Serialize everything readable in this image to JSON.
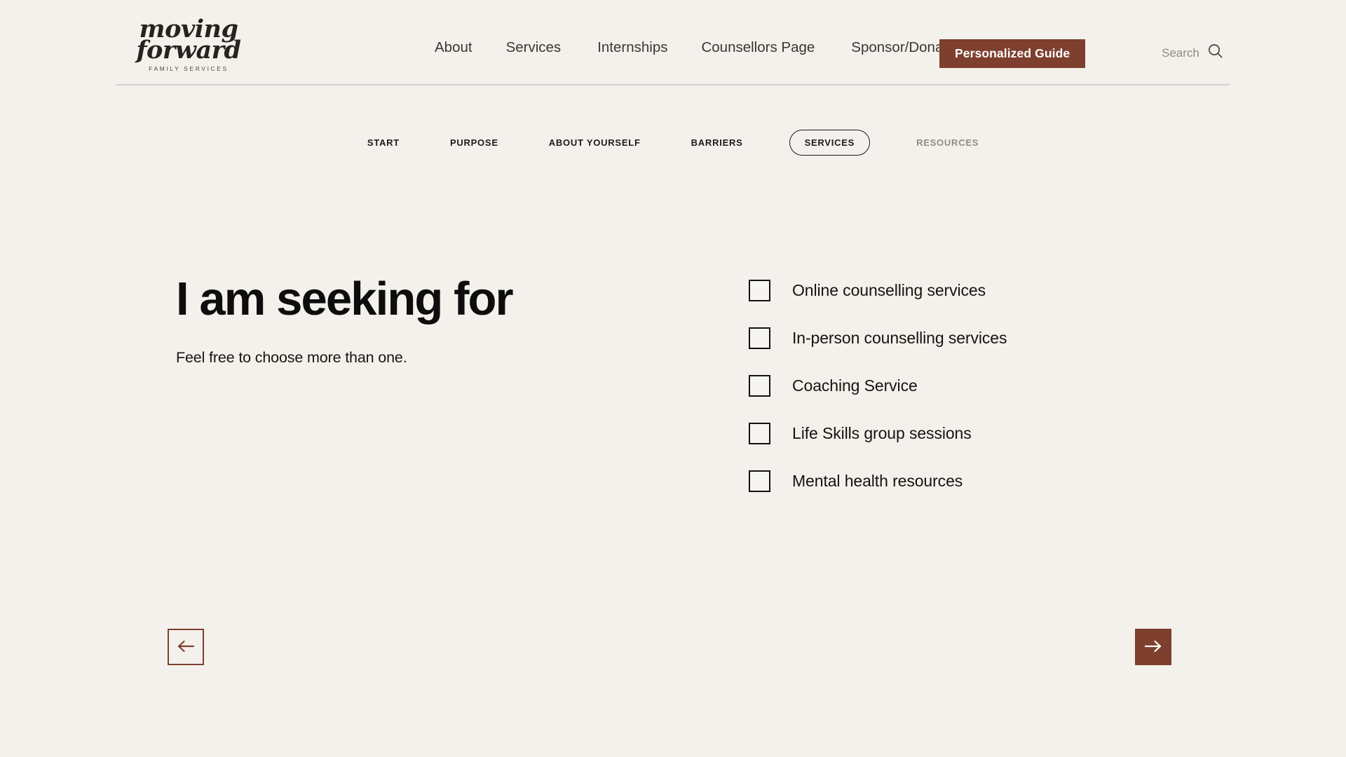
{
  "theme": {
    "background": "#f4f1ec",
    "accent": "#7e3f2e",
    "text": "#1b1b1b",
    "muted": "#8e8b86",
    "rule": "#d3d2cf"
  },
  "header": {
    "logo": {
      "line1": "moving",
      "line2": "forward",
      "tagline": "FAMILY SERVICES"
    },
    "nav_items": [
      {
        "label": "About"
      },
      {
        "label": "Services"
      },
      {
        "label": "Internships"
      },
      {
        "label": "Counsellors Page"
      },
      {
        "label": "Sponsor/Donate"
      }
    ],
    "cta_label": "Personalized Guide",
    "search": {
      "label": "Search",
      "icon": "search-icon"
    }
  },
  "stepper": {
    "steps": [
      {
        "label": "START",
        "state": "complete"
      },
      {
        "label": "PURPOSE",
        "state": "complete"
      },
      {
        "label": "ABOUT YOURSELF",
        "state": "complete"
      },
      {
        "label": "BARRIERS",
        "state": "complete"
      },
      {
        "label": "SERVICES",
        "state": "active"
      },
      {
        "label": "RESOURCES",
        "state": "disabled"
      }
    ]
  },
  "main": {
    "headline": "I am seeking for",
    "subhead": "Feel free to choose more than one.",
    "options": [
      {
        "label": "Online counselling services",
        "checked": false
      },
      {
        "label": "In-person counselling services",
        "checked": false
      },
      {
        "label": "Coaching Service",
        "checked": false
      },
      {
        "label": "Life Skills group sessions",
        "checked": false
      },
      {
        "label": "Mental health resources",
        "checked": false
      }
    ]
  },
  "footer_nav": {
    "prev": {
      "icon": "arrow-left-icon"
    },
    "next": {
      "icon": "arrow-right-icon"
    }
  }
}
